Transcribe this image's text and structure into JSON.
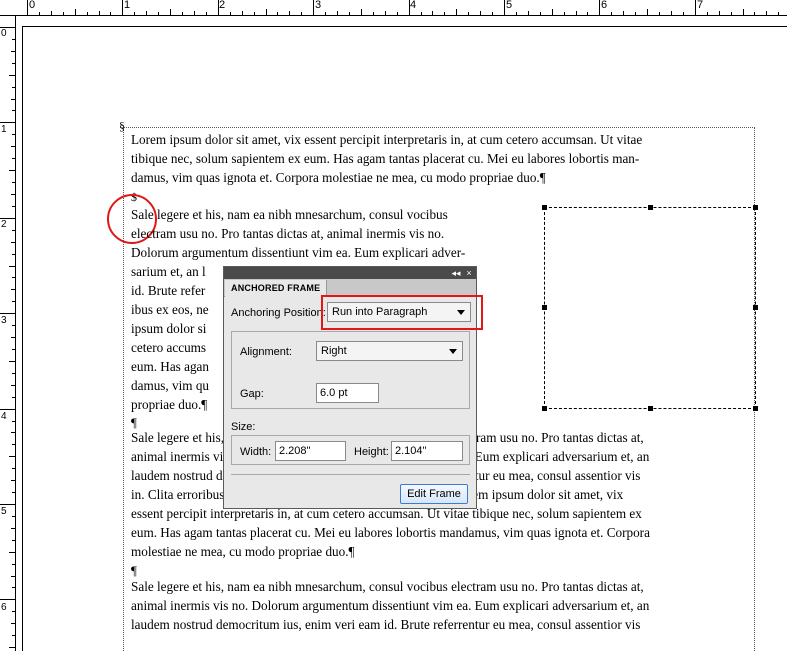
{
  "ruler": {
    "horizontal_numbers": [
      "0",
      "1",
      "2",
      "3",
      "4",
      "5",
      "6",
      "7"
    ],
    "vertical_numbers": [
      "0",
      "1",
      "2",
      "3",
      "4",
      "5",
      "6"
    ]
  },
  "document": {
    "section_marker": "§",
    "anchor_marker": "$",
    "paragraph_mark": "¶",
    "para1": [
      "Lorem ipsum dolor sit amet, vix essent percipit interpretaris in, at cum cetero accumsan. Ut vitae",
      "tibique nec, solum sapientem ex eum. Has agam tantas placerat cu. Mei eu labores lobortis man-",
      "damus, vim quas ignota et. Corpora molestiae ne mea, cu modo propriae duo.¶"
    ],
    "para2_lines": [
      "Sale legere et his, nam ea nibh mnesarchum, consul vocibus",
      "electram usu no. Pro tantas dictas at, animal inermis vis no.",
      "Dolorum argumentum dissentiunt vim ea. Eum explicari adver-",
      "sarium et, an l                                             eri eam",
      "id. Brute refer                                             ita error-",
      "ibus ex eos, ne                                             orem",
      "ipsum dolor si                                              at cum",
      "cetero accums                                              ex",
      "eum. Has agan                                              rtis man-",
      "damus, vim qu                                              cu modo",
      "propriae duo.¶"
    ],
    "para3": [
      "Sale legere et his, nam ea nibh mnesarchum, consul vocibus electram usu no. Pro tantas dictas at,",
      "animal inermis vis no. Dolorum argumentum dissentiunt vim ea. Eum explicari adversarium et, an",
      "laudem nostrud democritum ius, enim veri eam id. Brute referrentur eu mea, consul assentior vis",
      "in. Clita erroribus ex eos, ne sed diceret quaeque, qui mazim.Lorem ipsum dolor sit amet, vix",
      "essent percipit interpretaris in, at cum cetero accumsan. Ut vitae tibique nec, solum sapientem ex",
      "eum. Has agam tantas placerat cu. Mei eu labores lobortis mandamus, vim quas ignota et. Corpora",
      "molestiae ne mea, cu modo propriae duo.¶"
    ],
    "para4": [
      "Sale legere et his, nam ea nibh mnesarchum, consul vocibus electram usu no. Pro tantas dictas at,",
      "animal inermis vis no. Dolorum argumentum dissentiunt vim ea. Eum explicari adversarium et, an",
      "laudem nostrud democritum ius, enim veri eam id. Brute referrentur eu mea, consul assentior vis"
    ]
  },
  "panel": {
    "collapse_glyph": "◂◂",
    "close_glyph": "×",
    "tab_label": "ANCHORED FRAME",
    "anchoring_position_label": "Anchoring Position:",
    "anchoring_position_value": "Run into Paragraph",
    "alignment_label": "Alignment:",
    "alignment_value": "Right",
    "gap_label": "Gap:",
    "gap_value": "6.0 pt",
    "size_label": "Size:",
    "width_label": "Width:",
    "width_value": "2.208\"",
    "height_label": "Height:",
    "height_value": "2.104\"",
    "edit_frame_label": "Edit Frame"
  },
  "colors": {
    "highlight_red": "#e01818",
    "panel_bg": "#e8e8e8",
    "button_border": "#3b7bd6"
  }
}
